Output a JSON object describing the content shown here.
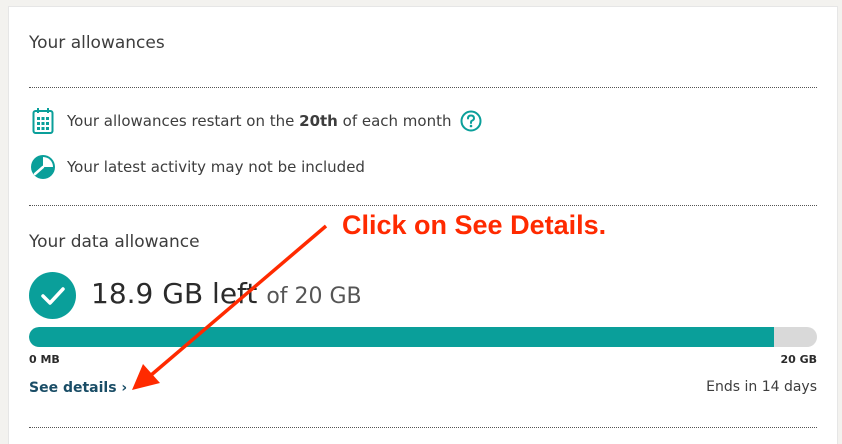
{
  "allowances": {
    "title": "Your allowances",
    "restart_prefix": "Your allowances restart on the ",
    "restart_day": "20th",
    "restart_suffix": " of each month",
    "activity_note": "Your latest activity may not be included"
  },
  "data_allowance": {
    "title": "Your data allowance",
    "remaining": "18.9 GB left",
    "total": "of 20 GB",
    "used_fraction": 0.945,
    "min_label": "0 MB",
    "max_label": "20 GB",
    "see_details": "See details",
    "ends": "Ends in 14 days"
  },
  "annotation": {
    "text": "Click on See Details."
  },
  "colors": {
    "accent": "#0a9f9a",
    "annotation": "#ff2a00",
    "link": "#1a4d66"
  }
}
